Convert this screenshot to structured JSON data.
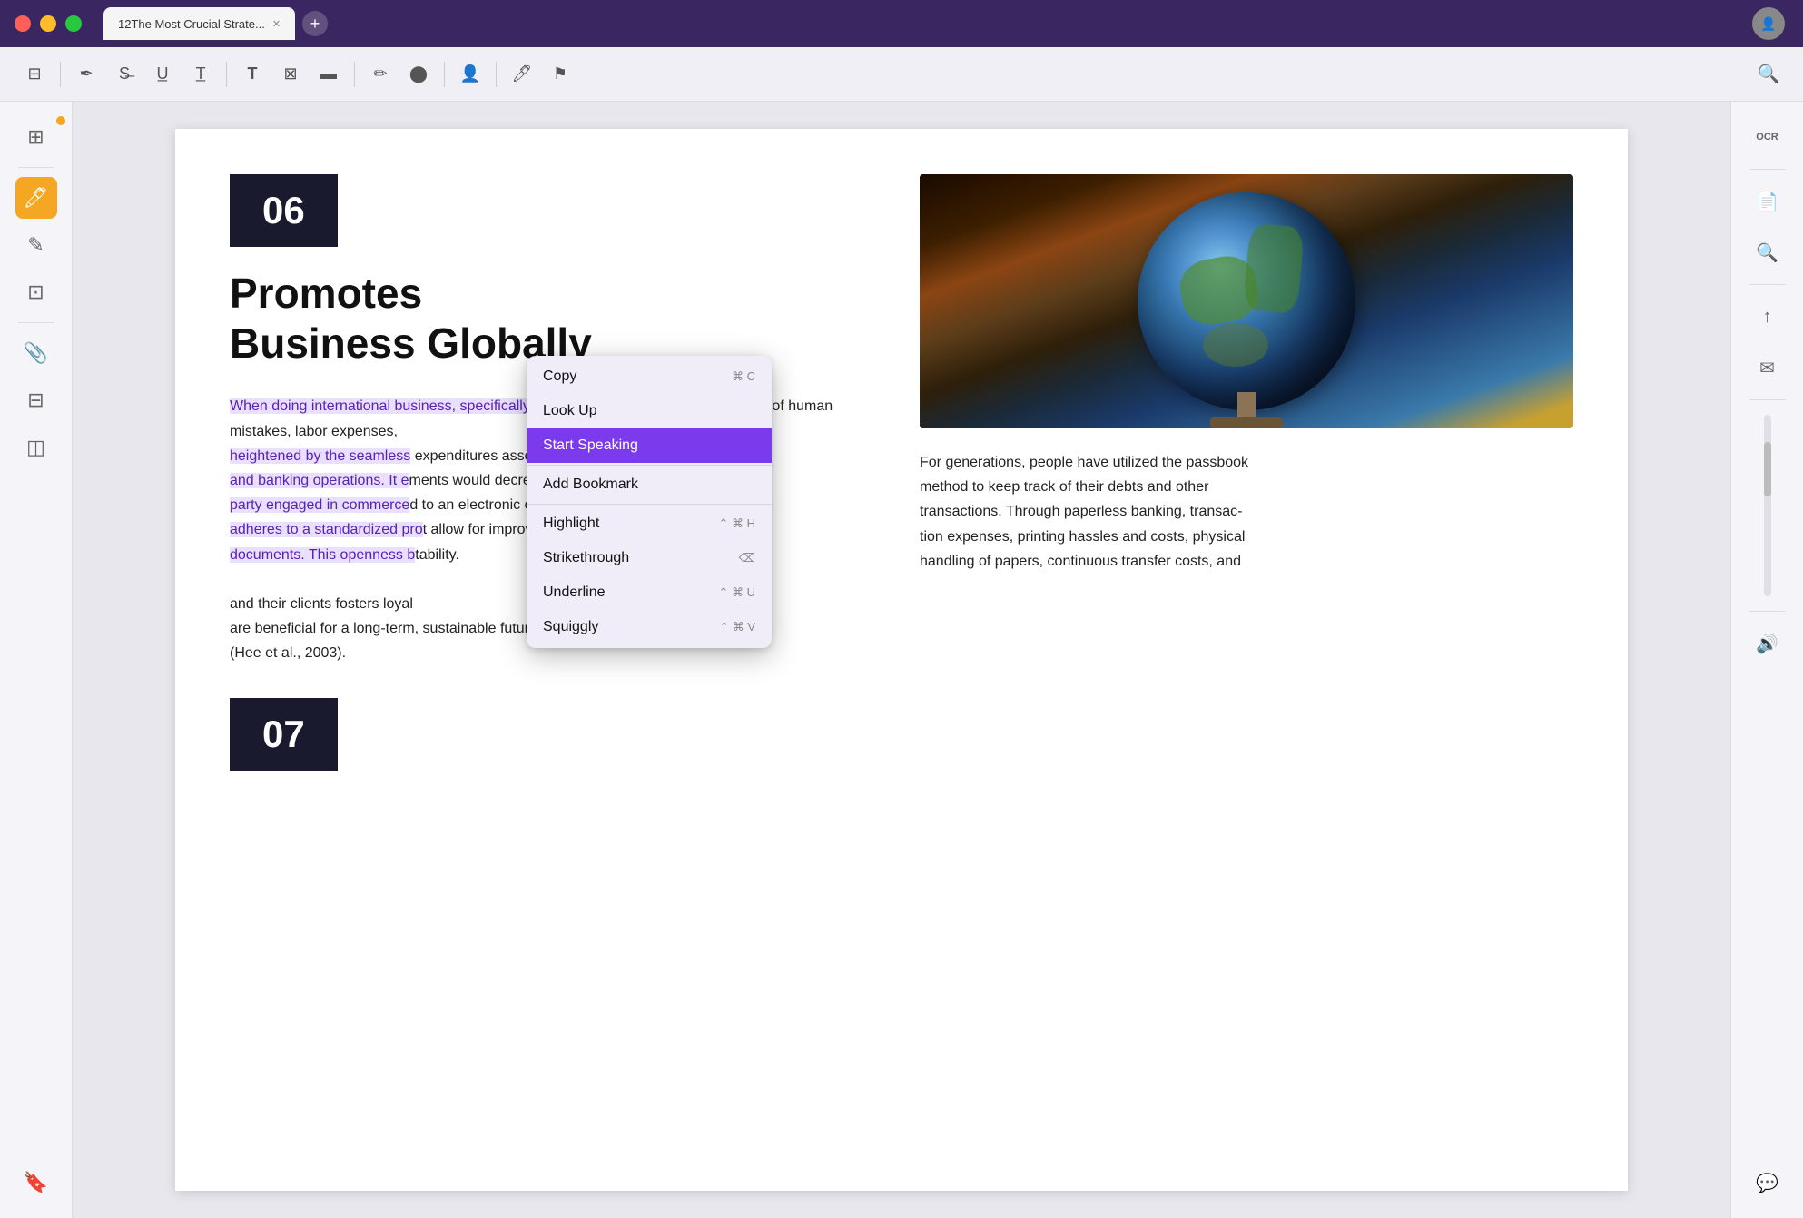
{
  "titlebar": {
    "tab_title": "12The Most Crucial Strate...",
    "tab_close": "✕",
    "tab_add": "+"
  },
  "toolbar": {
    "icons": [
      "reader-view",
      "highlight-tool",
      "strikethrough-tool",
      "underline-tool",
      "typewriter-tool",
      "text-tool",
      "stamp-tool",
      "redact-tool",
      "pen-tool",
      "color-picker-tool",
      "shape-tool",
      "user-tool",
      "annotation-tool"
    ],
    "search_label": "🔍"
  },
  "left_sidebar": {
    "items": [
      {
        "name": "thumbnails",
        "icon": "⊞"
      },
      {
        "name": "bookmarks",
        "icon": "🔖"
      },
      {
        "name": "annotations",
        "icon": "✎"
      },
      {
        "name": "layers",
        "icon": "⊟"
      },
      {
        "name": "highlight-pen",
        "icon": "🖊"
      },
      {
        "name": "pages",
        "icon": "⊡"
      },
      {
        "name": "attachments",
        "icon": "📎"
      },
      {
        "name": "stickers",
        "icon": "⭐"
      },
      {
        "name": "layers2",
        "icon": "◫"
      },
      {
        "name": "bookmark2",
        "icon": "🔖"
      }
    ]
  },
  "right_sidebar": {
    "items": [
      {
        "name": "ocr",
        "icon": "OCR"
      },
      {
        "name": "document-scan",
        "icon": "📄"
      },
      {
        "name": "search-doc",
        "icon": "🔍"
      },
      {
        "name": "share",
        "icon": "↑"
      },
      {
        "name": "email",
        "icon": "✉"
      },
      {
        "name": "audio",
        "icon": "🔊"
      },
      {
        "name": "comments",
        "icon": "💬"
      }
    ]
  },
  "page": {
    "section_number": "06",
    "section_title_line1": "Promotes",
    "section_title_line2": "Business Globally",
    "body_text_highlighted": "When doing international business, specifically, confidence between the ban",
    "body_text_highlighted2": "heightened by the seamless",
    "body_text_rest1": "number of human mistakes, labor expenses,",
    "body_text_rest2": "expenditures associated with processing docu-",
    "body_text_rest3": "ments would decrease if this procedure were con-",
    "body_text_rest4": "d to an electronic one. Reducing these costs",
    "body_text_rest5": "t allow for improved service and increased",
    "body_text_rest6": "tability.",
    "body_and": "and banking operations. It e",
    "body_party": "party engaged in commerce",
    "body_adheres": "adheres to a standardized pro",
    "body_documents": "documents. This openness b",
    "body_clients": "and their clients fosters loyal",
    "body_long": "are beneficial for a long-term, sustainable future",
    "body_citation": "(Hee et al., 2003).",
    "section_number_2": "07",
    "right_text1": "For generations, people have utilized the passbook",
    "right_text2": "method to keep track of their debts and other",
    "right_text3": "transactions. Through paperless banking, transac-",
    "right_text4": "tion expenses, printing hassles and costs, physical",
    "right_text5": "handling of papers, continuous transfer costs, and"
  },
  "context_menu": {
    "items": [
      {
        "label": "Copy",
        "shortcut": "⌘ C",
        "active": false
      },
      {
        "label": "Look Up",
        "shortcut": "",
        "active": false
      },
      {
        "label": "Start Speaking",
        "shortcut": "",
        "active": true
      },
      {
        "label": "Add Bookmark",
        "shortcut": "",
        "active": false
      },
      {
        "label": "Highlight",
        "shortcut": "⌃ ⌘ H",
        "active": false
      },
      {
        "label": "Strikethrough",
        "shortcut": "⌫",
        "active": false
      },
      {
        "label": "Underline",
        "shortcut": "⌃ ⌘ U",
        "active": false
      },
      {
        "label": "Squiggly",
        "shortcut": "⌃ ⌘ V",
        "active": false
      }
    ]
  }
}
